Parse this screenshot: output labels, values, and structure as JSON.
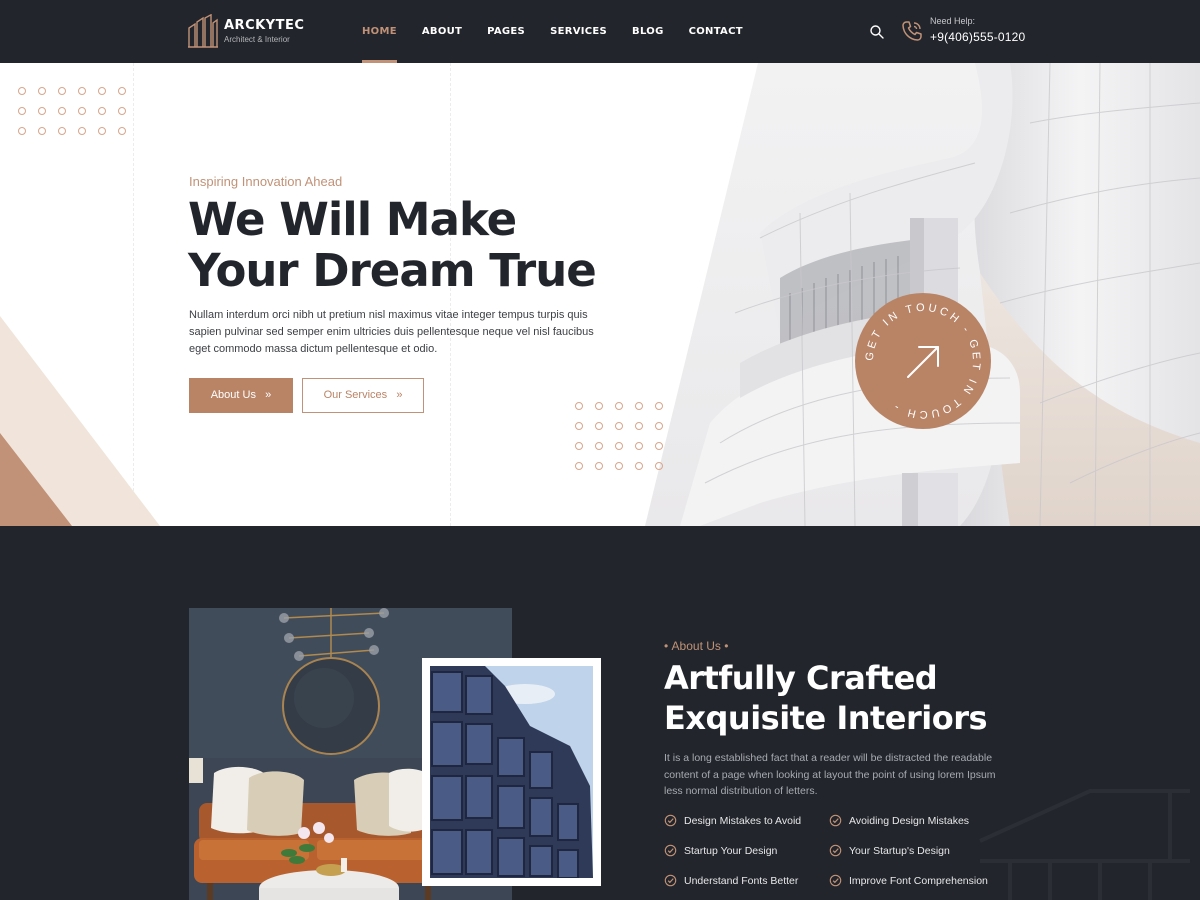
{
  "brand": {
    "name": "ARCKYTEC",
    "tagline": "Architect & Interior"
  },
  "nav": {
    "items": [
      {
        "label": "HOME",
        "active": true
      },
      {
        "label": "ABOUT",
        "active": false
      },
      {
        "label": "PAGES",
        "active": false
      },
      {
        "label": "SERVICES",
        "active": false
      },
      {
        "label": "BLOG",
        "active": false
      },
      {
        "label": "CONTACT",
        "active": false
      }
    ]
  },
  "header": {
    "search_icon": "search-icon",
    "phone_icon": "phone-icon",
    "help_label": "Need Help:",
    "help_phone": "+9(406)555-0120"
  },
  "hero": {
    "eyebrow": "Inspiring Innovation Ahead",
    "title_line1": "We Will Make",
    "title_line2": "Your Dream True",
    "description": "Nullam interdum orci nibh ut pretium nisl maximus vitae integer tempus turpis quis sapien pulvinar sed semper enim ultricies duis pellentesque neque vel nisl faucibus eget commodo massa dictum pellentesque et odio.",
    "primary_button": "About Us",
    "secondary_button": "Our Services",
    "button_icon": "double-chevron-right-icon",
    "badge_text": "GET IN TOUCH - GET IN TOUCH -",
    "badge_icon": "arrow-up-right-icon"
  },
  "about": {
    "eyebrow": "About Us",
    "title_line1": "Artfully Crafted",
    "title_line2": "Exquisite Interiors",
    "description": "It is a long established fact that a reader will be distracted the readable content of a page when looking at layout the point of using lorem Ipsum less normal distribution of letters.",
    "feature_icon": "check-circle-icon",
    "features": [
      "Design Mistakes to Avoid",
      "Avoiding Design Mistakes",
      "Startup Your Design",
      "Your Startup's Design",
      "Understand Fonts Better",
      "Improve Font Comprehension"
    ]
  },
  "colors": {
    "accent": "#c19277",
    "accent_dark": "#b98466",
    "dark": "#22252b",
    "light": "#ffffff"
  }
}
